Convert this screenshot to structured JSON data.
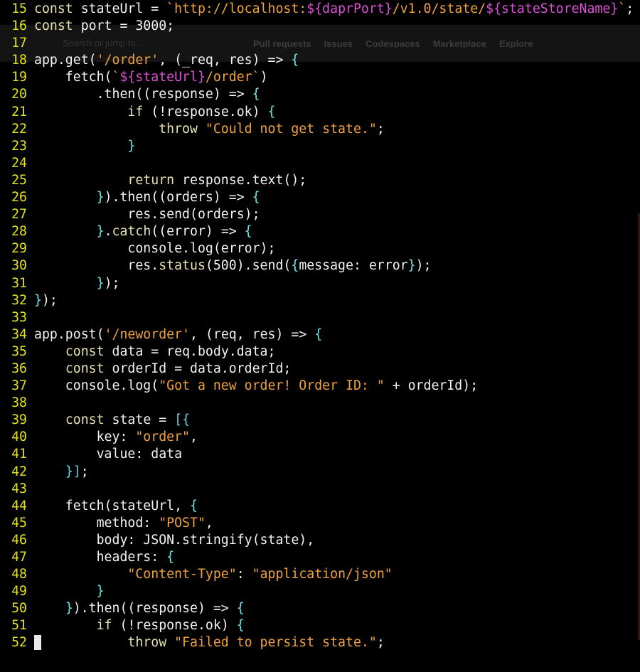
{
  "theme": {
    "background": "#000000",
    "line_number": "#e3e11e",
    "keyword": "#e7e2b0",
    "string": "#f0a33b",
    "template": "#dd4fd8",
    "bracket": "#6fe6e6",
    "text": "#f2f2f2"
  },
  "background_page": {
    "search_placeholder": "Search or jump to...",
    "nav_items": [
      "Pull requests",
      "Issues",
      "Codespaces",
      "Marketplace",
      "Explore"
    ]
  },
  "editor": {
    "cursor_line": 52,
    "lines": [
      {
        "n": "15",
        "segs": [
          [
            "kw",
            "const "
          ],
          [
            "fn",
            "stateUrl = "
          ],
          [
            "str",
            "`http://localhost:"
          ],
          [
            "tpl",
            "${daprPort}"
          ],
          [
            "str",
            "/v1.0/state/"
          ],
          [
            "tpl",
            "${stateStoreName}"
          ],
          [
            "str",
            "`"
          ],
          [
            "fn",
            ";"
          ]
        ]
      },
      {
        "n": "16",
        "segs": [
          [
            "kw",
            "const "
          ],
          [
            "fn",
            "port = 3000;"
          ]
        ]
      },
      {
        "n": "17",
        "segs": []
      },
      {
        "n": "18",
        "segs": [
          [
            "fn",
            "app.get("
          ],
          [
            "str",
            "'/order'"
          ],
          [
            "fn",
            ", (_req, res) => "
          ],
          [
            "brk",
            "{"
          ]
        ]
      },
      {
        "n": "19",
        "segs": [
          [
            "fn",
            "    fetch("
          ],
          [
            "str",
            "`"
          ],
          [
            "tpl",
            "${stateUrl}"
          ],
          [
            "str",
            "/order`"
          ],
          [
            "fn",
            ")"
          ]
        ]
      },
      {
        "n": "20",
        "segs": [
          [
            "fn",
            "        .then((response) => "
          ],
          [
            "brk",
            "{"
          ]
        ]
      },
      {
        "n": "21",
        "segs": [
          [
            "fn",
            "            "
          ],
          [
            "kw",
            "if "
          ],
          [
            "fn",
            "(!response.ok) "
          ],
          [
            "brk",
            "{"
          ]
        ]
      },
      {
        "n": "22",
        "segs": [
          [
            "fn",
            "                "
          ],
          [
            "kw",
            "throw "
          ],
          [
            "str",
            "\"Could not get state.\""
          ],
          [
            "fn",
            ";"
          ]
        ]
      },
      {
        "n": "23",
        "segs": [
          [
            "fn",
            "            "
          ],
          [
            "brk",
            "}"
          ]
        ]
      },
      {
        "n": "24",
        "segs": []
      },
      {
        "n": "25",
        "segs": [
          [
            "fn",
            "            "
          ],
          [
            "kw",
            "return "
          ],
          [
            "fn",
            "response.text();"
          ]
        ]
      },
      {
        "n": "26",
        "segs": [
          [
            "fn",
            "        "
          ],
          [
            "brk",
            "}"
          ],
          [
            "fn",
            ").then((orders) => "
          ],
          [
            "brk",
            "{"
          ]
        ]
      },
      {
        "n": "27",
        "segs": [
          [
            "fn",
            "            res.send(orders);"
          ]
        ]
      },
      {
        "n": "28",
        "segs": [
          [
            "fn",
            "        "
          ],
          [
            "brk",
            "}"
          ],
          [
            "fn",
            "."
          ],
          [
            "kw",
            "catch"
          ],
          [
            "fn",
            "((error) => "
          ],
          [
            "brk",
            "{"
          ]
        ]
      },
      {
        "n": "29",
        "segs": [
          [
            "fn",
            "            console.log(error);"
          ]
        ]
      },
      {
        "n": "30",
        "segs": [
          [
            "fn",
            "            res."
          ],
          [
            "kw",
            "status"
          ],
          [
            "fn",
            "(500).send("
          ],
          [
            "brk",
            "{"
          ],
          [
            "fn",
            "message: error"
          ],
          [
            "brk",
            "}"
          ],
          [
            "fn",
            ");"
          ]
        ]
      },
      {
        "n": "31",
        "segs": [
          [
            "fn",
            "        "
          ],
          [
            "brk",
            "}"
          ],
          [
            "fn",
            ");"
          ]
        ]
      },
      {
        "n": "32",
        "segs": [
          [
            "brk",
            "}"
          ],
          [
            "fn",
            ");"
          ]
        ]
      },
      {
        "n": "33",
        "segs": []
      },
      {
        "n": "34",
        "segs": [
          [
            "fn",
            "app.post("
          ],
          [
            "str",
            "'/neworder'"
          ],
          [
            "fn",
            ", (req, res) => "
          ],
          [
            "brk",
            "{"
          ]
        ]
      },
      {
        "n": "35",
        "segs": [
          [
            "fn",
            "    "
          ],
          [
            "kw",
            "const "
          ],
          [
            "fn",
            "data = req.body.data;"
          ]
        ]
      },
      {
        "n": "36",
        "segs": [
          [
            "fn",
            "    "
          ],
          [
            "kw",
            "const "
          ],
          [
            "fn",
            "orderId = data.orderId;"
          ]
        ]
      },
      {
        "n": "37",
        "segs": [
          [
            "fn",
            "    console.log("
          ],
          [
            "str",
            "\"Got a new order! Order ID: \""
          ],
          [
            "fn",
            " + orderId);"
          ]
        ]
      },
      {
        "n": "38",
        "segs": []
      },
      {
        "n": "39",
        "segs": [
          [
            "fn",
            "    "
          ],
          [
            "kw",
            "const "
          ],
          [
            "fn",
            "state = "
          ],
          [
            "sb",
            "[{"
          ]
        ]
      },
      {
        "n": "40",
        "segs": [
          [
            "fn",
            "        key: "
          ],
          [
            "str",
            "\"order\""
          ],
          [
            "fn",
            ","
          ]
        ]
      },
      {
        "n": "41",
        "segs": [
          [
            "fn",
            "        value: data"
          ]
        ]
      },
      {
        "n": "42",
        "segs": [
          [
            "fn",
            "    "
          ],
          [
            "sb",
            "}]"
          ],
          [
            "fn",
            ";"
          ]
        ]
      },
      {
        "n": "43",
        "segs": []
      },
      {
        "n": "44",
        "segs": [
          [
            "fn",
            "    fetch(stateUrl, "
          ],
          [
            "brk",
            "{"
          ]
        ]
      },
      {
        "n": "45",
        "segs": [
          [
            "fn",
            "        method: "
          ],
          [
            "str",
            "\"POST\""
          ],
          [
            "fn",
            ","
          ]
        ]
      },
      {
        "n": "46",
        "segs": [
          [
            "fn",
            "        body: JSON.stringify(state),"
          ]
        ]
      },
      {
        "n": "47",
        "segs": [
          [
            "fn",
            "        headers: "
          ],
          [
            "brk",
            "{"
          ]
        ]
      },
      {
        "n": "48",
        "segs": [
          [
            "fn",
            "            "
          ],
          [
            "str",
            "\"Content-Type\""
          ],
          [
            "fn",
            ": "
          ],
          [
            "str",
            "\"application/json\""
          ]
        ]
      },
      {
        "n": "49",
        "segs": [
          [
            "fn",
            "        "
          ],
          [
            "brk",
            "}"
          ]
        ]
      },
      {
        "n": "50",
        "segs": [
          [
            "fn",
            "    "
          ],
          [
            "brk",
            "}"
          ],
          [
            "fn",
            ").then((response) => "
          ],
          [
            "brk",
            "{"
          ]
        ]
      },
      {
        "n": "51",
        "segs": [
          [
            "fn",
            "        "
          ],
          [
            "kw",
            "if "
          ],
          [
            "fn",
            "(!response.ok) "
          ],
          [
            "brk",
            "{"
          ]
        ]
      },
      {
        "n": "52",
        "segs": [
          [
            "fn",
            "            "
          ],
          [
            "kw",
            "throw "
          ],
          [
            "str",
            "\"Failed to persist state.\""
          ],
          [
            "fn",
            ";"
          ]
        ]
      }
    ]
  }
}
